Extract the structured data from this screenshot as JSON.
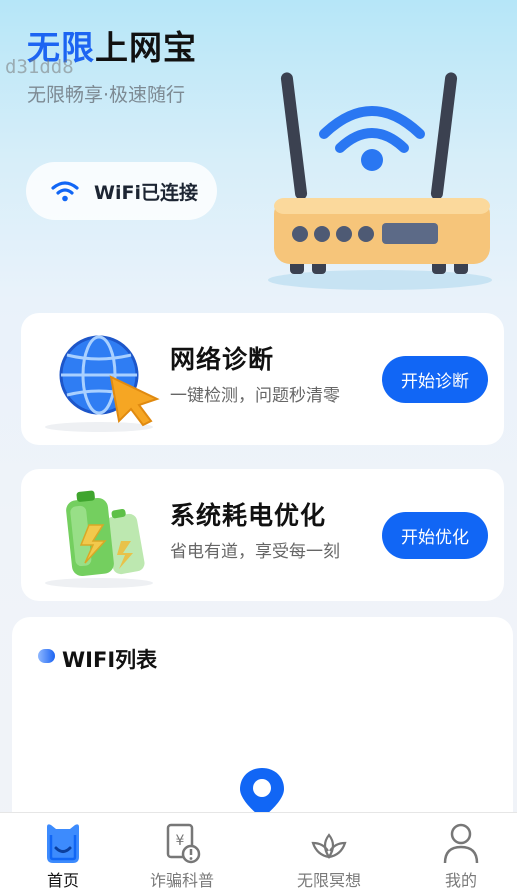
{
  "header": {
    "title_part1": "无限",
    "title_part2": "上网宝",
    "watermark": "d31dd8",
    "slogan": "无限畅享·极速随行"
  },
  "wifi_status": {
    "icon": "wifi-icon",
    "label": "WiFi已连接"
  },
  "cards": [
    {
      "title": "网络诊断",
      "desc": "一键检测，问题秒清零",
      "button": "开始诊断",
      "icon": "globe-cursor-icon"
    },
    {
      "title": "系统耗电优化",
      "desc": "省电有道，享受每一刻",
      "button": "开始优化",
      "icon": "battery-icon"
    }
  ],
  "wifi_list": {
    "title": "WIFI列表"
  },
  "tabs": [
    {
      "label": "首页",
      "icon": "home-cat-icon",
      "active": true
    },
    {
      "label": "诈骗科普",
      "icon": "fraud-alert-icon",
      "active": false
    },
    {
      "label": "无限冥想",
      "icon": "lotus-icon",
      "active": false
    },
    {
      "label": "我的",
      "icon": "user-icon",
      "active": false
    }
  ],
  "colors": {
    "accent": "#1166f5",
    "title_blue": "#1c64f2",
    "router_body": "#f6c57a"
  }
}
